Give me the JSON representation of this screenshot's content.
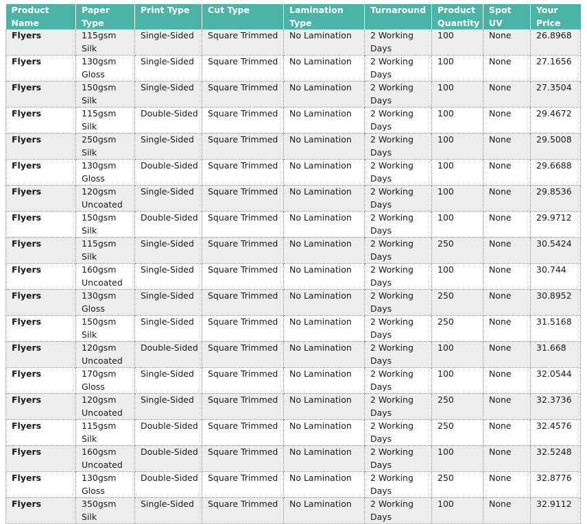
{
  "table": {
    "headers": [
      "Product Name",
      "Paper Type",
      "Print Type",
      "Cut Type",
      "Lamination Type",
      "Turnaround",
      "Product Quantity",
      "Spot UV",
      "Your Price"
    ],
    "rows": [
      [
        "Flyers",
        "115gsm Silk",
        "Single-Sided",
        "Square Trimmed",
        "No Lamination",
        "2 Working Days",
        "100",
        "None",
        "26.8968"
      ],
      [
        "Flyers",
        "130gsm Gloss",
        "Single-Sided",
        "Square Trimmed",
        "No Lamination",
        "2 Working Days",
        "100",
        "None",
        "27.1656"
      ],
      [
        "Flyers",
        "150gsm Silk",
        "Single-Sided",
        "Square Trimmed",
        "No Lamination",
        "2 Working Days",
        "100",
        "None",
        "27.3504"
      ],
      [
        "Flyers",
        "115gsm Silk",
        "Double-Sided",
        "Square Trimmed",
        "No Lamination",
        "2 Working Days",
        "100",
        "None",
        "29.4672"
      ],
      [
        "Flyers",
        "250gsm Silk",
        "Single-Sided",
        "Square Trimmed",
        "No Lamination",
        "2 Working Days",
        "100",
        "None",
        "29.5008"
      ],
      [
        "Flyers",
        "130gsm Gloss",
        "Double-Sided",
        "Square Trimmed",
        "No Lamination",
        "2 Working Days",
        "100",
        "None",
        "29.6688"
      ],
      [
        "Flyers",
        "120gsm Uncoated",
        "Single-Sided",
        "Square Trimmed",
        "No Lamination",
        "2 Working Days",
        "100",
        "None",
        "29.8536"
      ],
      [
        "Flyers",
        "150gsm Silk",
        "Double-Sided",
        "Square Trimmed",
        "No Lamination",
        "2 Working Days",
        "100",
        "None",
        "29.9712"
      ],
      [
        "Flyers",
        "115gsm Silk",
        "Single-Sided",
        "Square Trimmed",
        "No Lamination",
        "2 Working Days",
        "250",
        "None",
        "30.5424"
      ],
      [
        "Flyers",
        "160gsm Uncoated",
        "Single-Sided",
        "Square Trimmed",
        "No Lamination",
        "2 Working Days",
        "100",
        "None",
        "30.744"
      ],
      [
        "Flyers",
        "130gsm Gloss",
        "Single-Sided",
        "Square Trimmed",
        "No Lamination",
        "2 Working Days",
        "250",
        "None",
        "30.8952"
      ],
      [
        "Flyers",
        "150gsm Silk",
        "Single-Sided",
        "Square Trimmed",
        "No Lamination",
        "2 Working Days",
        "250",
        "None",
        "31.5168"
      ],
      [
        "Flyers",
        "120gsm Uncoated",
        "Double-Sided",
        "Square Trimmed",
        "No Lamination",
        "2 Working Days",
        "100",
        "None",
        "31.668"
      ],
      [
        "Flyers",
        "170gsm Gloss",
        "Single-Sided",
        "Square Trimmed",
        "No Lamination",
        "2 Working Days",
        "100",
        "None",
        "32.0544"
      ],
      [
        "Flyers",
        "120gsm Uncoated",
        "Single-Sided",
        "Square Trimmed",
        "No Lamination",
        "2 Working Days",
        "250",
        "None",
        "32.3736"
      ],
      [
        "Flyers",
        "115gsm Silk",
        "Double-Sided",
        "Square Trimmed",
        "No Lamination",
        "2 Working Days",
        "250",
        "None",
        "32.4576"
      ],
      [
        "Flyers",
        "160gsm Uncoated",
        "Double-Sided",
        "Square Trimmed",
        "No Lamination",
        "2 Working Days",
        "100",
        "None",
        "32.5248"
      ],
      [
        "Flyers",
        "130gsm Gloss",
        "Double-Sided",
        "Square Trimmed",
        "No Lamination",
        "2 Working Days",
        "250",
        "None",
        "32.8776"
      ],
      [
        "Flyers",
        "350gsm Silk",
        "Single-Sided",
        "Square Trimmed",
        "No Lamination",
        "2 Working Days",
        "100",
        "None",
        "32.9112"
      ]
    ]
  },
  "colors": {
    "header_bg": "#4bb4a6",
    "header_text": "#ffffff",
    "row_alt_bg": "#ededed"
  }
}
